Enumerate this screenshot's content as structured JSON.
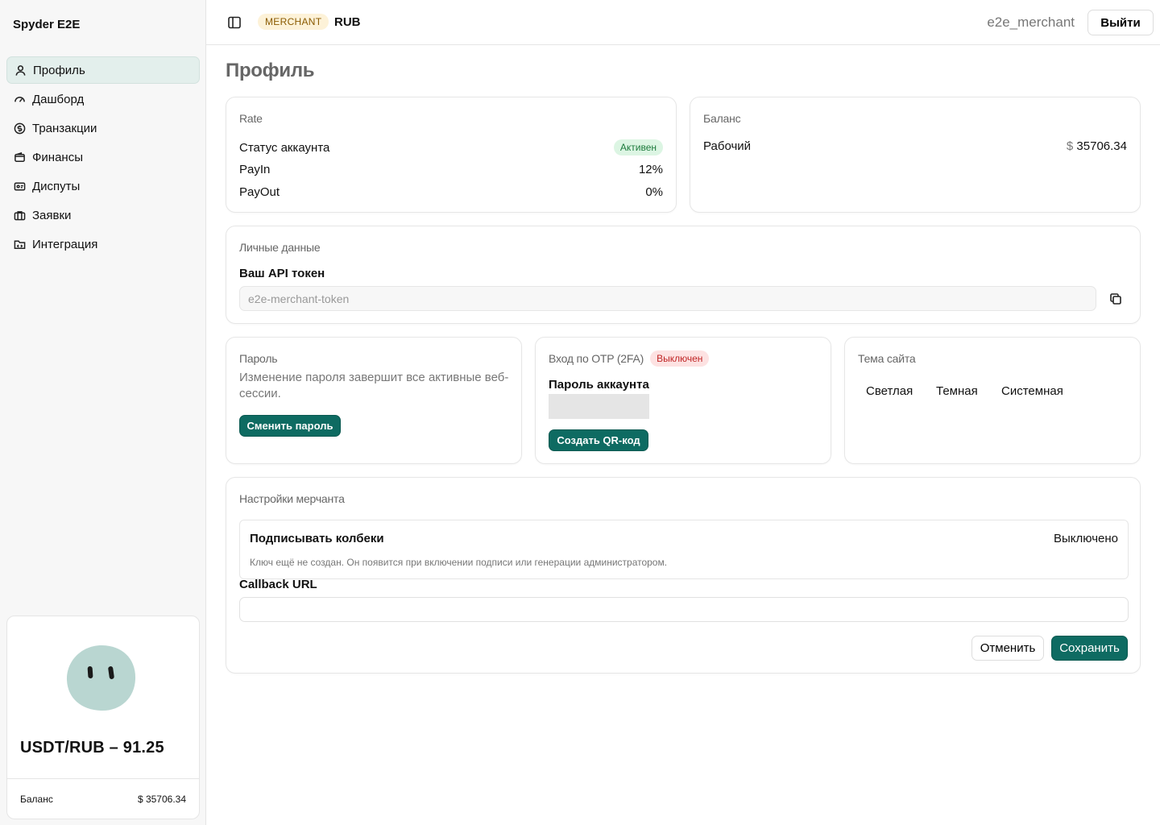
{
  "sidebar": {
    "brand": "Spyder E2E",
    "items": [
      {
        "label": "Профиль",
        "icon": "user-icon"
      },
      {
        "label": "Дашборд",
        "icon": "gauge-icon"
      },
      {
        "label": "Транзакции",
        "icon": "dollar-circle-icon"
      },
      {
        "label": "Финансы",
        "icon": "wallet-icon"
      },
      {
        "label": "Диспуты",
        "icon": "ticket-icon"
      },
      {
        "label": "Заявки",
        "icon": "briefcase-icon"
      },
      {
        "label": "Интеграция",
        "icon": "folder-icon"
      }
    ],
    "rate_card": {
      "rate": "USDT/RUB – 91.25",
      "balance_label": "Баланс",
      "balance_value": "$ 35706.34"
    }
  },
  "header": {
    "role_badge": "MERCHANT",
    "currency": "RUB",
    "username": "e2e_merchant",
    "logout_label": "Выйти"
  },
  "page": {
    "title": "Профиль"
  },
  "rate_section": {
    "title": "Rate",
    "status_label": "Статус аккаунта",
    "status_value": "Активен",
    "payin_label": "PayIn",
    "payin_value": "12%",
    "payout_label": "PayOut",
    "payout_value": "0%"
  },
  "balance_section": {
    "title": "Баланс",
    "work_label": "Рабочий",
    "currency_sign": "$",
    "work_value": "35706.34"
  },
  "personal_section": {
    "title": "Личные данные",
    "token_label": "Ваш API токен",
    "token_value": "e2e-merchant-token"
  },
  "password_section": {
    "title": "Пароль",
    "description": "Изменение пароля завершит все активные веб-сессии.",
    "button": "Сменить пароль"
  },
  "otp_section": {
    "title": "Вход по OTP (2FA)",
    "status": "Выключен",
    "password_label": "Пароль аккаунта",
    "button": "Создать QR-код"
  },
  "theme_section": {
    "title": "Тема сайта",
    "options": [
      "Светлая",
      "Темная",
      "Системная"
    ]
  },
  "merchant_section": {
    "title": "Настройки мерчанта",
    "sign_label": "Подписывать колбеки",
    "sign_value": "Выключено",
    "sign_hint": "Ключ ещё не создан. Он появится при включении подписи или генерации администратором.",
    "callback_label": "Callback URL",
    "callback_value": "",
    "cancel_label": "Отменить",
    "save_label": "Сохранить"
  },
  "colors": {
    "accent": "#0e6b62",
    "active_nav": "#e3efec",
    "success": "#1c7a3c",
    "danger": "#c02525"
  }
}
